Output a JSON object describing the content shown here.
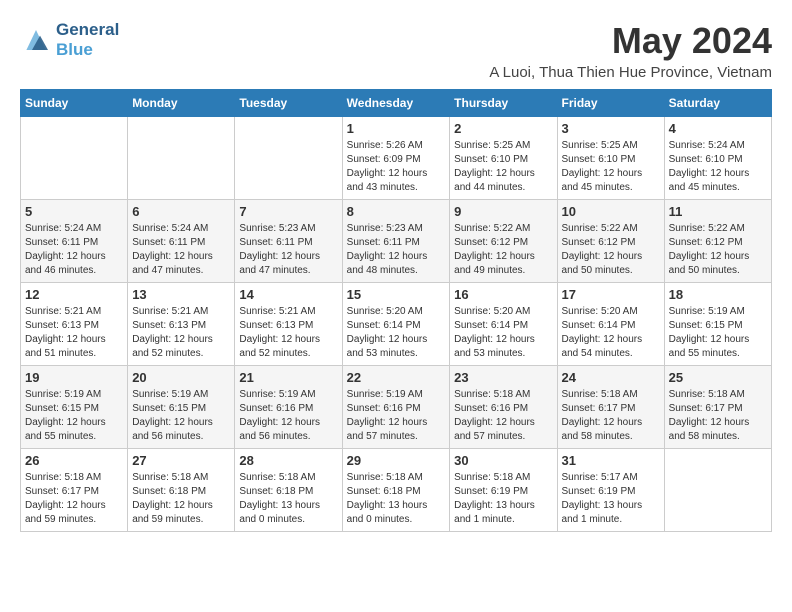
{
  "header": {
    "logo_line1": "General",
    "logo_line2": "Blue",
    "month_year": "May 2024",
    "location": "A Luoi, Thua Thien Hue Province, Vietnam"
  },
  "days_of_week": [
    "Sunday",
    "Monday",
    "Tuesday",
    "Wednesday",
    "Thursday",
    "Friday",
    "Saturday"
  ],
  "weeks": [
    [
      {
        "day": "",
        "info": ""
      },
      {
        "day": "",
        "info": ""
      },
      {
        "day": "",
        "info": ""
      },
      {
        "day": "1",
        "info": "Sunrise: 5:26 AM\nSunset: 6:09 PM\nDaylight: 12 hours\nand 43 minutes."
      },
      {
        "day": "2",
        "info": "Sunrise: 5:25 AM\nSunset: 6:10 PM\nDaylight: 12 hours\nand 44 minutes."
      },
      {
        "day": "3",
        "info": "Sunrise: 5:25 AM\nSunset: 6:10 PM\nDaylight: 12 hours\nand 45 minutes."
      },
      {
        "day": "4",
        "info": "Sunrise: 5:24 AM\nSunset: 6:10 PM\nDaylight: 12 hours\nand 45 minutes."
      }
    ],
    [
      {
        "day": "5",
        "info": "Sunrise: 5:24 AM\nSunset: 6:11 PM\nDaylight: 12 hours\nand 46 minutes."
      },
      {
        "day": "6",
        "info": "Sunrise: 5:24 AM\nSunset: 6:11 PM\nDaylight: 12 hours\nand 47 minutes."
      },
      {
        "day": "7",
        "info": "Sunrise: 5:23 AM\nSunset: 6:11 PM\nDaylight: 12 hours\nand 47 minutes."
      },
      {
        "day": "8",
        "info": "Sunrise: 5:23 AM\nSunset: 6:11 PM\nDaylight: 12 hours\nand 48 minutes."
      },
      {
        "day": "9",
        "info": "Sunrise: 5:22 AM\nSunset: 6:12 PM\nDaylight: 12 hours\nand 49 minutes."
      },
      {
        "day": "10",
        "info": "Sunrise: 5:22 AM\nSunset: 6:12 PM\nDaylight: 12 hours\nand 50 minutes."
      },
      {
        "day": "11",
        "info": "Sunrise: 5:22 AM\nSunset: 6:12 PM\nDaylight: 12 hours\nand 50 minutes."
      }
    ],
    [
      {
        "day": "12",
        "info": "Sunrise: 5:21 AM\nSunset: 6:13 PM\nDaylight: 12 hours\nand 51 minutes."
      },
      {
        "day": "13",
        "info": "Sunrise: 5:21 AM\nSunset: 6:13 PM\nDaylight: 12 hours\nand 52 minutes."
      },
      {
        "day": "14",
        "info": "Sunrise: 5:21 AM\nSunset: 6:13 PM\nDaylight: 12 hours\nand 52 minutes."
      },
      {
        "day": "15",
        "info": "Sunrise: 5:20 AM\nSunset: 6:14 PM\nDaylight: 12 hours\nand 53 minutes."
      },
      {
        "day": "16",
        "info": "Sunrise: 5:20 AM\nSunset: 6:14 PM\nDaylight: 12 hours\nand 53 minutes."
      },
      {
        "day": "17",
        "info": "Sunrise: 5:20 AM\nSunset: 6:14 PM\nDaylight: 12 hours\nand 54 minutes."
      },
      {
        "day": "18",
        "info": "Sunrise: 5:19 AM\nSunset: 6:15 PM\nDaylight: 12 hours\nand 55 minutes."
      }
    ],
    [
      {
        "day": "19",
        "info": "Sunrise: 5:19 AM\nSunset: 6:15 PM\nDaylight: 12 hours\nand 55 minutes."
      },
      {
        "day": "20",
        "info": "Sunrise: 5:19 AM\nSunset: 6:15 PM\nDaylight: 12 hours\nand 56 minutes."
      },
      {
        "day": "21",
        "info": "Sunrise: 5:19 AM\nSunset: 6:16 PM\nDaylight: 12 hours\nand 56 minutes."
      },
      {
        "day": "22",
        "info": "Sunrise: 5:19 AM\nSunset: 6:16 PM\nDaylight: 12 hours\nand 57 minutes."
      },
      {
        "day": "23",
        "info": "Sunrise: 5:18 AM\nSunset: 6:16 PM\nDaylight: 12 hours\nand 57 minutes."
      },
      {
        "day": "24",
        "info": "Sunrise: 5:18 AM\nSunset: 6:17 PM\nDaylight: 12 hours\nand 58 minutes."
      },
      {
        "day": "25",
        "info": "Sunrise: 5:18 AM\nSunset: 6:17 PM\nDaylight: 12 hours\nand 58 minutes."
      }
    ],
    [
      {
        "day": "26",
        "info": "Sunrise: 5:18 AM\nSunset: 6:17 PM\nDaylight: 12 hours\nand 59 minutes."
      },
      {
        "day": "27",
        "info": "Sunrise: 5:18 AM\nSunset: 6:18 PM\nDaylight: 12 hours\nand 59 minutes."
      },
      {
        "day": "28",
        "info": "Sunrise: 5:18 AM\nSunset: 6:18 PM\nDaylight: 13 hours\nand 0 minutes."
      },
      {
        "day": "29",
        "info": "Sunrise: 5:18 AM\nSunset: 6:18 PM\nDaylight: 13 hours\nand 0 minutes."
      },
      {
        "day": "30",
        "info": "Sunrise: 5:18 AM\nSunset: 6:19 PM\nDaylight: 13 hours\nand 1 minute."
      },
      {
        "day": "31",
        "info": "Sunrise: 5:17 AM\nSunset: 6:19 PM\nDaylight: 13 hours\nand 1 minute."
      },
      {
        "day": "",
        "info": ""
      }
    ]
  ]
}
